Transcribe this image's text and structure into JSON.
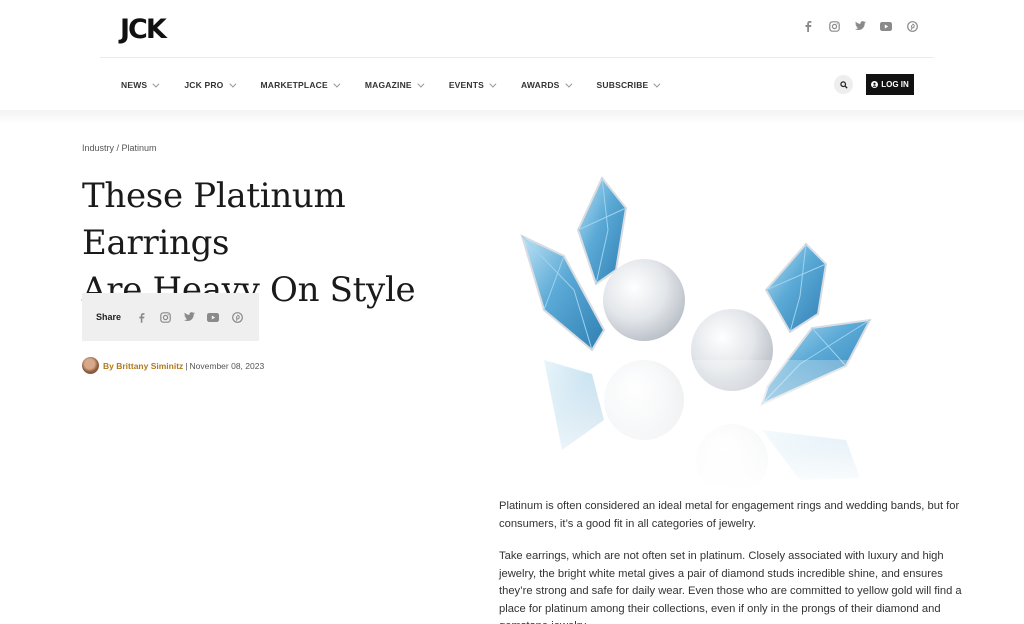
{
  "brand": {
    "logo_text": "JCK"
  },
  "social_top": [
    "facebook-icon",
    "instagram-icon",
    "twitter-icon",
    "youtube-icon",
    "pinterest-icon"
  ],
  "nav": {
    "items": [
      {
        "label": "NEWS"
      },
      {
        "label": "JCK PRO"
      },
      {
        "label": "MARKETPLACE"
      },
      {
        "label": "MAGAZINE"
      },
      {
        "label": "EVENTS"
      },
      {
        "label": "AWARDS"
      },
      {
        "label": "SUBSCRIBE"
      }
    ],
    "login_label": "LOG IN"
  },
  "article": {
    "breadcrumb": "Industry / Platinum",
    "title_line1": "These Platinum Earrings",
    "title_line2": "Are Heavy On Style",
    "share_label": "Share",
    "author": "By Brittany Siminitz",
    "separator": "|",
    "date": "November 08, 2023",
    "paragraphs": [
      "Platinum is often considered an ideal metal for engagement rings and wedding bands, but for consumers, it’s a good fit in all categories of jewelry.",
      "Take earrings, which are not often set in platinum. Closely associated with luxury and high jewelry, the bright white metal gives a pair of diamond studs incredible shine, and ensures they’re strong and safe for daily wear. Even those who are committed to yellow gold will find a place for platinum among their collections, even if only in the prongs of their diamond and gemstone jewelry."
    ]
  },
  "colors": {
    "accent_author": "#b07a1a",
    "login_bg": "#111111",
    "share_bg": "#efefef",
    "gem_blue": "#6fb6dd"
  }
}
